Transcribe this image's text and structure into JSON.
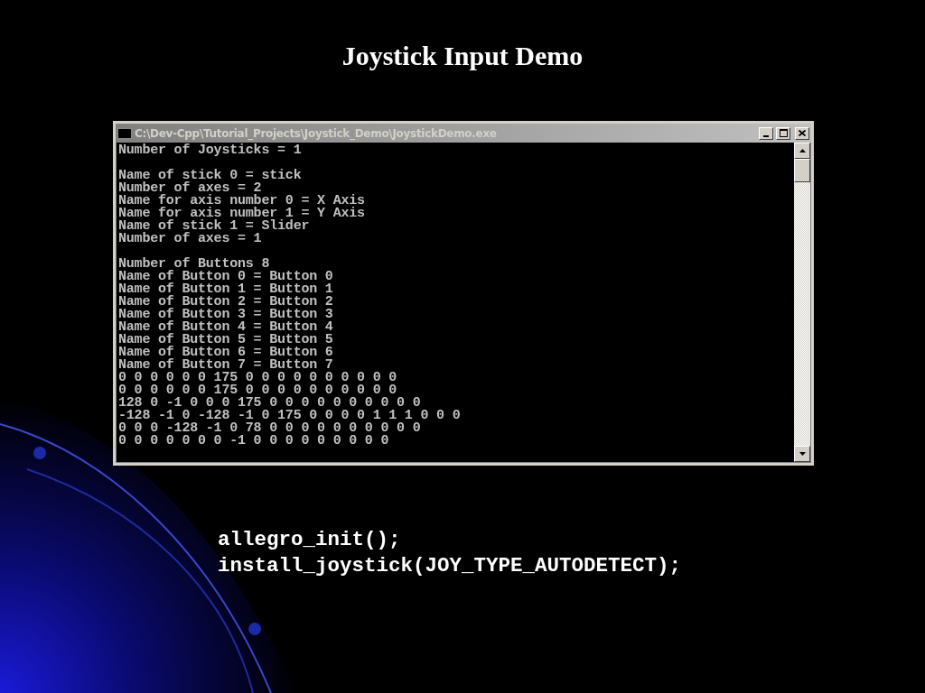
{
  "slide": {
    "title": "Joystick Input Demo"
  },
  "console_window": {
    "title": "C:\\Dev-Cpp\\Tutorial_Projects\\Joystick_Demo\\JoystickDemo.exe",
    "active": false,
    "output_blocks": [
      [
        "Number of Joysticks = 1"
      ],
      [
        "Name of stick 0 = stick",
        "Number of axes = 2",
        "Name for axis number 0 = X Axis",
        "Name for axis number 1 = Y Axis",
        "Name of stick 1 = Slider",
        "Number of axes = 1"
      ],
      [
        "Number of Buttons 8",
        "Name of Button 0 = Button 0",
        "Name of Button 1 = Button 1",
        "Name of Button 2 = Button 2",
        "Name of Button 3 = Button 3",
        "Name of Button 4 = Button 4",
        "Name of Button 5 = Button 5",
        "Name of Button 6 = Button 6",
        "Name of Button 7 = Button 7",
        "0 0 0 0 0 0 175 0 0 0 0 0 0 0 0 0 0",
        "0 0 0 0 0 0 175 0 0 0 0 0 0 0 0 0 0",
        "128 0 -1 0 0 0 175 0 0 0 0 0 0 0 0 0 0",
        "-128 -1 0 -128 -1 0 175 0 0 0 0 1 1 1 0 0 0",
        "0 0 0 -128 -1 0 78 0 0 0 0 0 0 0 0 0 0",
        "0 0 0 0 0 0 0 -1 0 0 0 0 0 0 0 0 0"
      ]
    ]
  },
  "code_lines": [
    "allegro_init();",
    "install_joystick(JOY_TYPE_AUTODETECT);"
  ]
}
